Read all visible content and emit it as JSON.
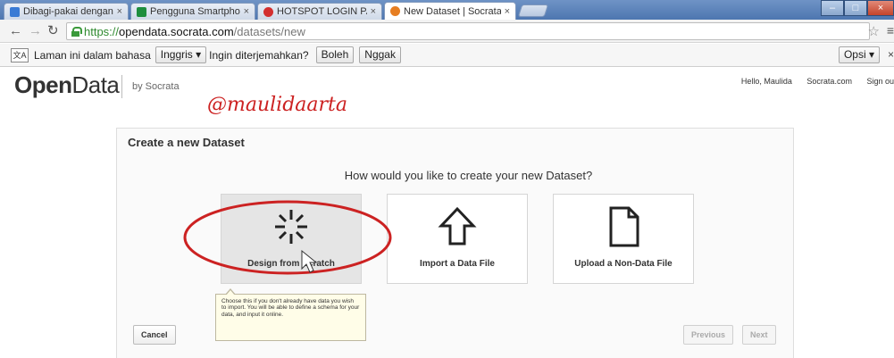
{
  "browser": {
    "tabs": [
      {
        "label": "Dibagi-pakai dengan saya",
        "favicon_color": "#3a7bd5"
      },
      {
        "label": "Pengguna Smartphone - I",
        "favicon_color": "#1e8e3e"
      },
      {
        "label": "HOTSPOT LOGIN PAGE",
        "favicon_color": "#d32f2f"
      },
      {
        "label": "New Dataset | Socrata",
        "favicon_color": "#e67e22"
      }
    ],
    "tab_close_glyph": "×",
    "url": {
      "scheme": "https://",
      "host": "opendata.socrata.com",
      "path": "/datasets/new"
    },
    "icons": {
      "back": "back-arrow-icon",
      "forward": "forward-arrow-icon",
      "reload": "reload-icon",
      "lock": "lock-icon",
      "star": "bookmark-star-icon",
      "menu": "menu-icon"
    }
  },
  "translate_bar": {
    "text_prefix": "Laman ini dalam bahasa",
    "language": "Inggris",
    "question": "Ingin diterjemahkan?",
    "yes_label": "Boleh",
    "no_label": "Nggak",
    "options_label": "Opsi",
    "close_glyph": "×"
  },
  "header": {
    "logo_bold": "Open",
    "logo_light": "Data",
    "by_line": "by Socrata",
    "watermark": "@maulidaarta",
    "user_links": [
      "Hello, Maulida",
      "Socrata.com",
      "Sign ou"
    ]
  },
  "wizard": {
    "title": "Create a new Dataset",
    "question": "How would you like to create your new Dataset?",
    "options": [
      {
        "label": "Design from Scratch",
        "icon": "spark-icon",
        "selected": true
      },
      {
        "label": "Import a Data File",
        "icon": "upload-arrow-icon",
        "selected": false
      },
      {
        "label": "Upload a Non-Data File",
        "icon": "document-icon",
        "selected": false
      }
    ],
    "tooltip": "Choose this if you don't already have data you wish to import. You will be able to define a schema for your data, and input it online.",
    "cancel_label": "Cancel",
    "previous_label": "Previous",
    "next_label": "Next"
  },
  "colors": {
    "annotation_red": "#cc2222",
    "selected_option_bg": "#e5e5e5"
  }
}
